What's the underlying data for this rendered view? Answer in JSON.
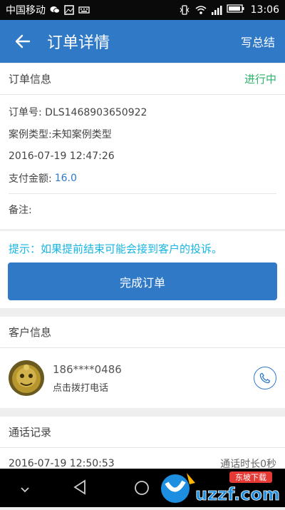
{
  "statusbar": {
    "carrier": "中国移动",
    "time": "13:06"
  },
  "appbar": {
    "title": "订单详情",
    "action": "写总结",
    "back_icon": "arrow-left-icon"
  },
  "order_info": {
    "header": "订单信息",
    "status": "进行中",
    "order_no": "订单号: DLS1468903650922",
    "case_type": "案例类型:未知案例类型",
    "datetime": "2016-07-19 12:47:26",
    "amount_label": "支付金额:",
    "amount_value": "16.0",
    "remark": "备注:"
  },
  "hint": "提示：如果提前结束可能会接到客户的投诉。",
  "complete_button": "完成订单",
  "customer": {
    "header": "客户信息",
    "phone": "186****0486",
    "call_text": "点击拨打电话"
  },
  "call_log": {
    "header": "通话记录",
    "entries": [
      {
        "time": "2016-07-19 12:50:53",
        "duration": "通话时长0秒"
      }
    ]
  },
  "watermark": {
    "brand": "uzzf.com",
    "sub": "东坡下载"
  },
  "colors": {
    "primary": "#2f79c7",
    "status_green": "#2db36a",
    "hint_cyan": "#18b5e0"
  }
}
